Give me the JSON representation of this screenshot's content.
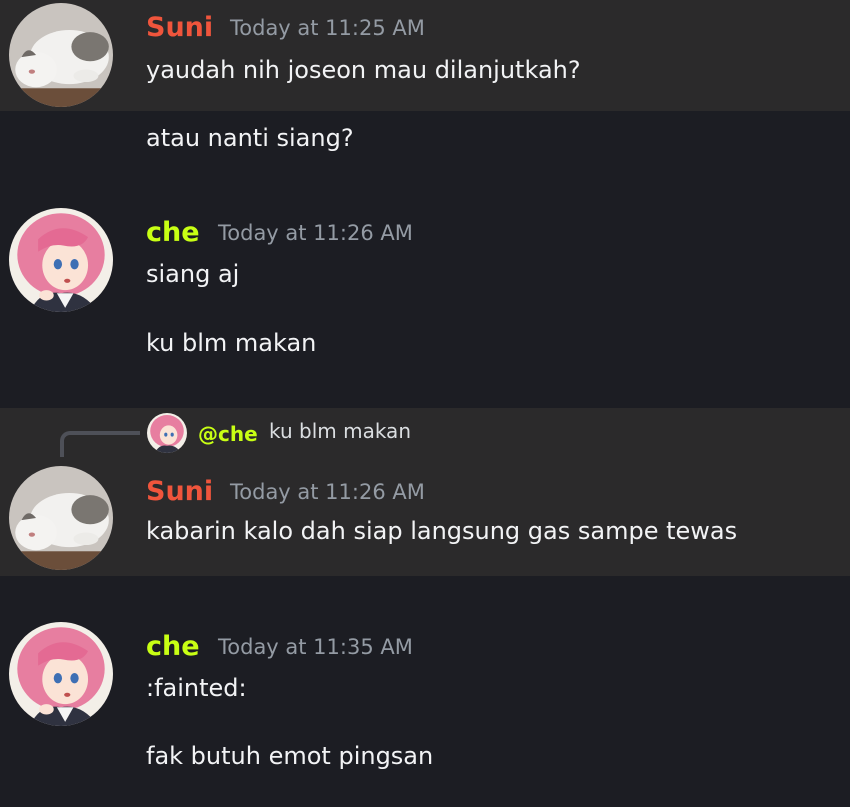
{
  "messages": [
    {
      "author": "Suni",
      "timestamp": "Today at 11:25 AM",
      "lines": [
        "yaudah nih joseon mau dilanjutkah?",
        "atau nanti siang?"
      ]
    },
    {
      "author": "che",
      "timestamp": "Today at 11:26 AM",
      "lines": [
        "siang aj",
        "ku blm makan"
      ]
    },
    {
      "reply": {
        "mention": "@che",
        "text": "ku blm makan"
      },
      "author": "Suni",
      "timestamp": "Today at 11:26 AM",
      "lines": [
        "kabarin kalo dah siap langsung gas sampe tewas"
      ]
    },
    {
      "author": "che",
      "timestamp": "Today at 11:35 AM",
      "lines": [
        ":fainted:",
        "fak butuh emot pingsan"
      ]
    }
  ],
  "colors": {
    "background": "#1c1d23",
    "highlight": "#2b2a2b",
    "suni_name": "#f0553c",
    "che_name": "#c8ff14",
    "timestamp": "#949ba4"
  }
}
